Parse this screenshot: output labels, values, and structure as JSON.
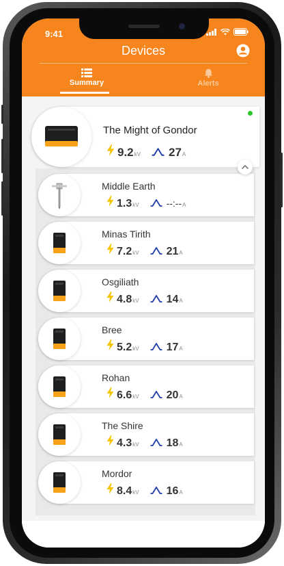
{
  "status_bar": {
    "time": "9:41"
  },
  "header": {
    "title": "Devices"
  },
  "tabs": [
    {
      "label": "Summary",
      "icon": "list-icon",
      "active": true
    },
    {
      "label": "Alerts",
      "icon": "bell-icon",
      "active": false
    }
  ],
  "colors": {
    "brand": "#f7851d",
    "online": "#2ec52e",
    "bolt": "#f5c400",
    "amp": "#1f3fa6"
  },
  "primary_device": {
    "name": "The Might of Gondor",
    "voltage": "9.2",
    "voltage_unit": "kV",
    "current": "27",
    "current_unit": "A",
    "online": true
  },
  "devices": [
    {
      "name": "Middle Earth",
      "voltage": "1.3",
      "voltage_unit": "kV",
      "current": "--:--",
      "current_unit": "A",
      "icon": "probe-icon"
    },
    {
      "name": "Minas Tirith",
      "voltage": "7.2",
      "voltage_unit": "kV",
      "current": "21",
      "current_unit": "A",
      "icon": "energizer-icon"
    },
    {
      "name": "Osgiliath",
      "voltage": "4.8",
      "voltage_unit": "kV",
      "current": "14",
      "current_unit": "A",
      "icon": "energizer-icon"
    },
    {
      "name": "Bree",
      "voltage": "5.2",
      "voltage_unit": "kV",
      "current": "17",
      "current_unit": "A",
      "icon": "energizer-icon"
    },
    {
      "name": "Rohan",
      "voltage": "6.6",
      "voltage_unit": "kV",
      "current": "20",
      "current_unit": "A",
      "icon": "energizer-icon"
    },
    {
      "name": "The Shire",
      "voltage": "4.3",
      "voltage_unit": "kV",
      "current": "18",
      "current_unit": "A",
      "icon": "energizer-icon"
    },
    {
      "name": "Mordor",
      "voltage": "8.4",
      "voltage_unit": "kV",
      "current": "16",
      "current_unit": "A",
      "icon": "energizer-icon"
    }
  ]
}
